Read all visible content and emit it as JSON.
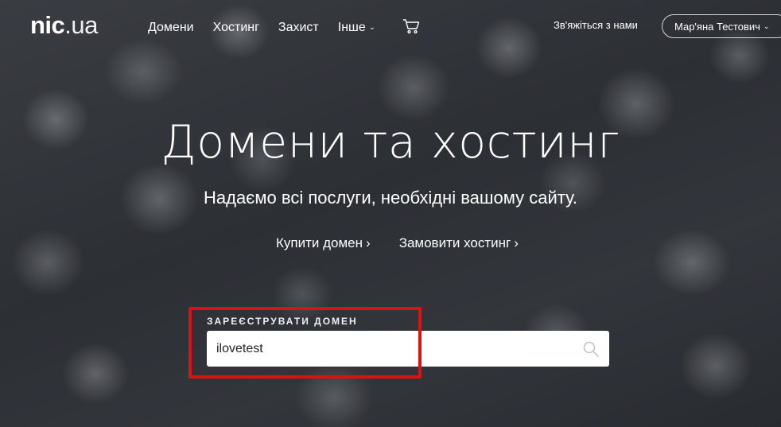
{
  "header": {
    "logo_main": "nic",
    "logo_suffix": ".ua",
    "nav": [
      {
        "label": "Домени"
      },
      {
        "label": "Хостинг"
      },
      {
        "label": "Захист"
      },
      {
        "label": "Інше"
      }
    ],
    "contact_label": "Зв'яжіться з нами",
    "user_name": "Мар'яна Тестович"
  },
  "hero": {
    "title": "Домени та хостинг",
    "subtitle": "Надаємо всі послуги, необхідні вашому сайту.",
    "buy_domain_label": "Купити домен",
    "order_hosting_label": "Замовити хостинг"
  },
  "search": {
    "label": "ЗАРЕЄСТРУВАТИ ДОМЕН",
    "value": "ilovetest"
  },
  "colors": {
    "highlight": "#e01010",
    "input_bg": "#ffffff"
  },
  "icons": [
    "cart-icon",
    "search-icon",
    "chevron-down-icon",
    "chevron-right-icon"
  ]
}
